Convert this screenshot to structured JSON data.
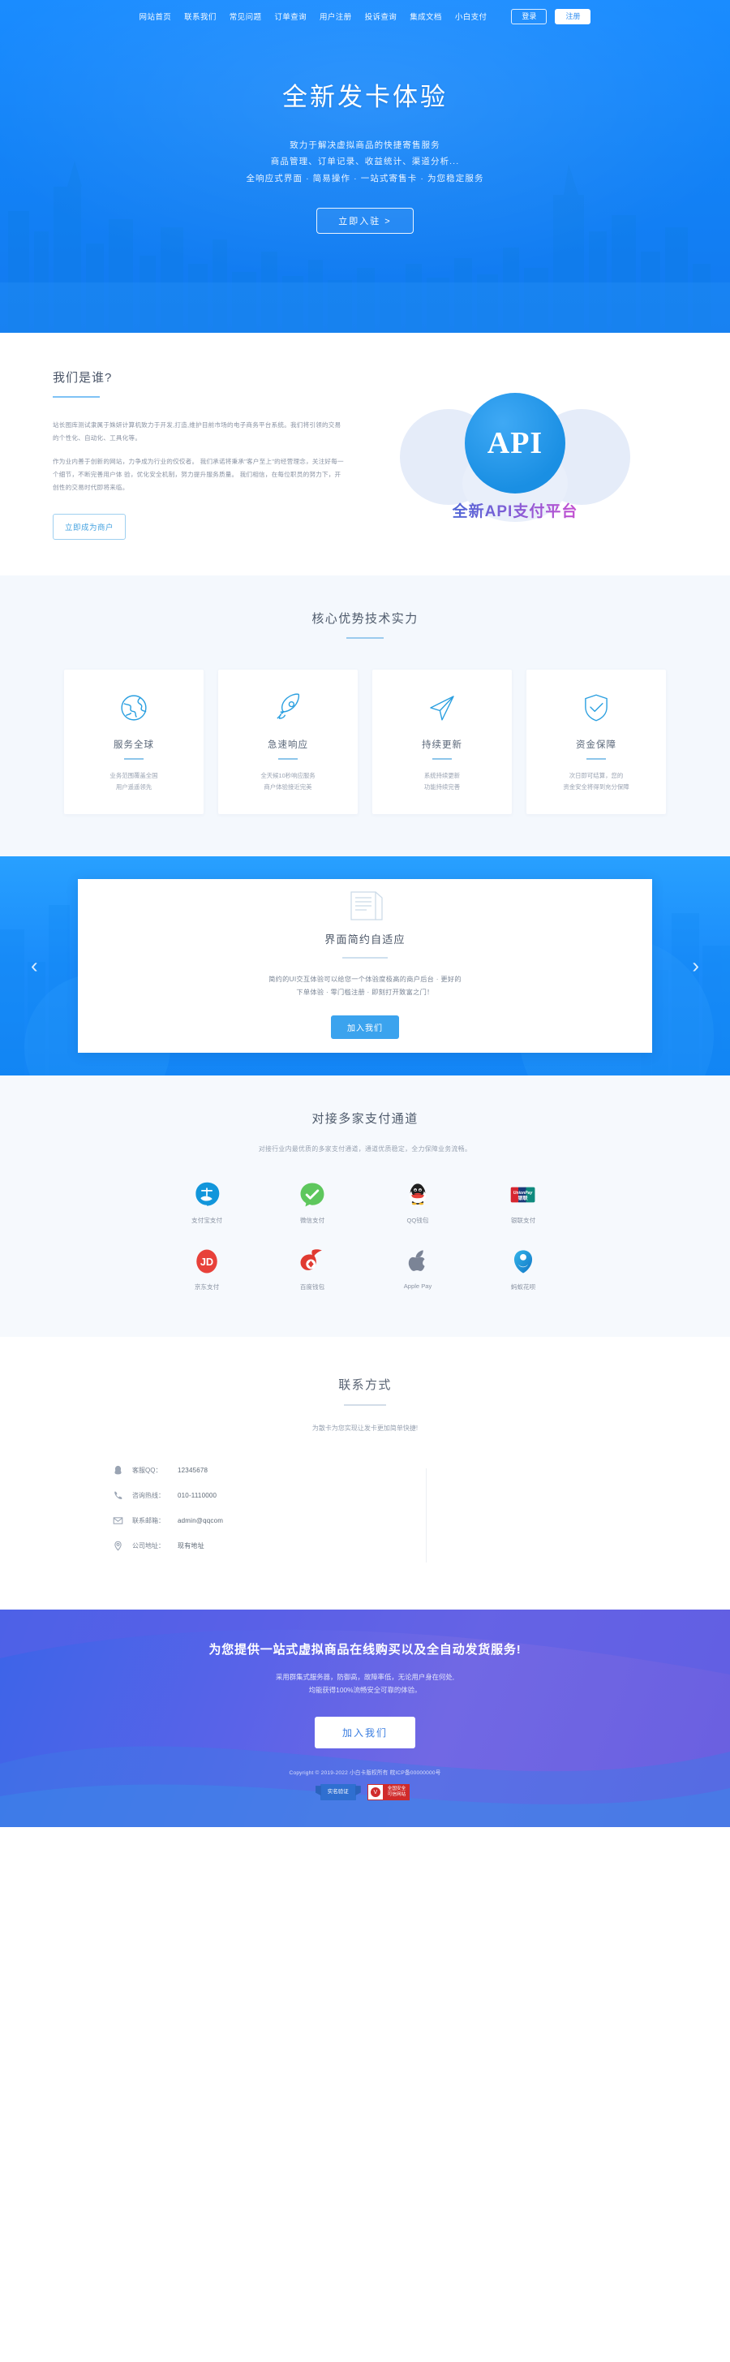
{
  "nav": {
    "links": [
      {
        "label": "网站首页"
      },
      {
        "label": "联系我们"
      },
      {
        "label": "常见问题"
      },
      {
        "label": "订单查询"
      },
      {
        "label": "用户注册"
      },
      {
        "label": "投诉查询"
      },
      {
        "label": "集成文档"
      },
      {
        "label": "小白支付"
      }
    ],
    "login_label": "登录",
    "register_label": "注册"
  },
  "hero": {
    "title": "全新发卡体验",
    "lines": [
      "致力于解决虚拟商品的快捷寄售服务",
      "商品管理、订单记录、收益统计、渠道分析...",
      "全响应式界面 · 简易操作 · 一站式寄售卡 · 为您稳定服务"
    ],
    "cta_label": "立即入驻 >"
  },
  "who": {
    "heading": "我们是谁?",
    "paragraphs": [
      "站长图库测试隶属于姝妍计算机致力于开发,打造,维护目前市场的电子商务平台系统。我们将引领的交易的个性化、自动化、工具化等。",
      "作为业内善于创新的网站，力争成为行业的佼佼者。 我们承诺将秉承\"客户至上\"的经营理念，关注好每一个细节，不断完善用户体 验，优化安全机制，努力提升服务质量。 我们相信，在每位职员的努力下，开创性的交易时代即将来临。"
    ],
    "button_label": "立即成为商户",
    "art_text": "API",
    "art_caption": "全新API支付平台"
  },
  "core": {
    "heading": "核心优势技术实力",
    "cards": [
      {
        "icon": "globe-icon",
        "title": "服务全球",
        "desc": "业务范围覆盖全国\n用户遥遥领先"
      },
      {
        "icon": "rocket-icon",
        "title": "急速响应",
        "desc": "全天候10秒响应服务\n商户体验接近完美"
      },
      {
        "icon": "paper-plane-icon",
        "title": "持续更新",
        "desc": "系统持续更新\n功能持续完善"
      },
      {
        "icon": "shield-check-icon",
        "title": "资金保障",
        "desc": "次日即可结算，您的\n资金安全将得到充分保障"
      }
    ]
  },
  "carousel": {
    "prev_label": "‹",
    "next_label": "›",
    "slide": {
      "title": "界面简约自适应",
      "desc": "简约的UI交互体验可以给您一个体验度极高的商户后台 · 更好的\n下单体验 · 零门槛注册 · 即刻打开致富之门！",
      "button_label": "加入我们"
    }
  },
  "payments": {
    "heading": "对接多家支付通道",
    "subheading": "对接行业内最优质的多家支付通道，通道优质稳定，全力保障业务流畅。",
    "items": [
      {
        "icon": "alipay-icon",
        "label": "支付宝支付"
      },
      {
        "icon": "wechat-pay-icon",
        "label": "微信支付"
      },
      {
        "icon": "qq-wallet-icon",
        "label": "QQ钱包"
      },
      {
        "icon": "unionpay-icon",
        "label": "银联支付"
      },
      {
        "icon": "jd-pay-icon",
        "label": "京东支付"
      },
      {
        "icon": "baidu-wallet-icon",
        "label": "百度钱包"
      },
      {
        "icon": "apple-pay-icon",
        "label": "Apple Pay"
      },
      {
        "icon": "huabei-icon",
        "label": "蚂蚁花呗"
      }
    ]
  },
  "contact": {
    "heading": "联系方式",
    "subheading": "为散卡为您实现让发卡更加简单快捷!",
    "rows": [
      {
        "icon": "qq-icon",
        "label": "客服QQ：",
        "value": "12345678"
      },
      {
        "icon": "phone-icon",
        "label": "咨询热线：",
        "value": "010-1110000"
      },
      {
        "icon": "mail-icon",
        "label": "联系邮箱：",
        "value": "admin@qqcom"
      },
      {
        "icon": "location-icon",
        "label": "公司地址：",
        "value": "现有地址"
      }
    ]
  },
  "footer": {
    "headline": "为您提供一站式虚拟商品在线购买以及全自动发货服务!",
    "sublines": [
      "采用群集式服务器，防御高，故障率低，无论用户身在何处,",
      "均能获得100%流畅安全可靠的体验。"
    ],
    "button_label": "加入我们",
    "copyright": "Copyright © 2019-2022 小白卡版权所有 皖ICP备00000000号",
    "badge_realname": "实名验证",
    "badge_safe_line1": "全国安全",
    "badge_safe_line2": "可信网站"
  },
  "colors": {
    "brand_blue": "#1a8cff",
    "accent_cyan": "#2a9fe0",
    "footer_purple": "#6a5fe0"
  }
}
